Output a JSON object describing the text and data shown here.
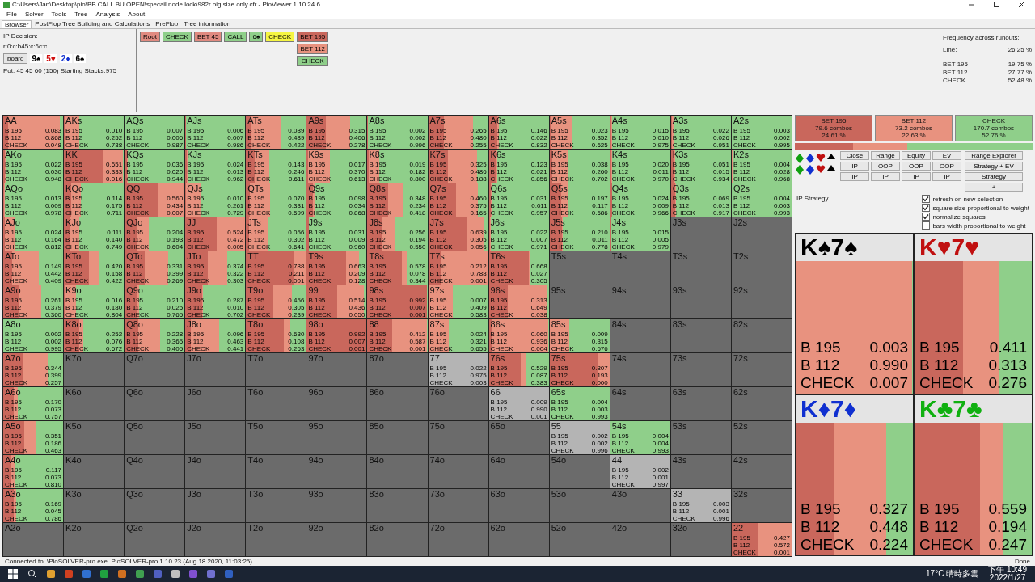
{
  "window": {
    "title": "C:\\Users\\Jan\\Desktop\\pio\\BB CALL BU OPEN\\specail node lock\\982r big size only.cfr - PioViewer 1.10.24.6"
  },
  "menu": [
    "File",
    "Solver",
    "Tools",
    "Tree",
    "Analysis",
    "About"
  ],
  "tabs": [
    {
      "label": "Browser",
      "selected": true
    },
    {
      "label": "PostFlop Tree Building and Calculations",
      "selected": false
    },
    {
      "label": "PreFlop",
      "selected": false
    },
    {
      "label": "Tree information",
      "selected": false
    }
  ],
  "decision": {
    "title": "IP Decision:",
    "line": "r:0:c:b45:c:6c:c",
    "board_button": "board",
    "cards": [
      {
        "label": "9♠",
        "color": "#000000"
      },
      {
        "label": "5♥",
        "color": "#d01010"
      },
      {
        "label": "2♦",
        "color": "#1030d0"
      },
      {
        "label": "6♠",
        "color": "#000000"
      }
    ],
    "pot": "Pot: 45 45 60 (150) Starting Stacks:975"
  },
  "path": [
    {
      "label": "Root",
      "color": "#e08a80"
    },
    {
      "label": "CHECK",
      "color": "#8fcf8a"
    },
    {
      "label": "BET 45",
      "color": "#e08a80"
    },
    {
      "label": "CALL",
      "color": "#8fcf8a"
    },
    {
      "label": "6♠",
      "color": "#8fcf8a"
    },
    {
      "label": "CHECK",
      "color": "#f5f542"
    }
  ],
  "next_actions": [
    {
      "label": "BET 195",
      "color": "#c9675c"
    },
    {
      "label": "BET 112",
      "color": "#e8927f"
    },
    {
      "label": "CHECK",
      "color": "#8fcf8a"
    }
  ],
  "runouts": {
    "title": "Frequency across runouts:",
    "line_label": "Line:",
    "line_value": "26.25 %",
    "rows": [
      [
        "BET 195",
        "19.75 %"
      ],
      [
        "BET 112",
        "27.77 %"
      ],
      [
        "CHECK",
        "52.48 %"
      ]
    ]
  },
  "strategy": {
    "actions": [
      {
        "name": "BET 195",
        "combos": "79.6 combos",
        "percent": "24.61 %",
        "color": "#c9675c"
      },
      {
        "name": "BET 112",
        "combos": "73.2 combos",
        "percent": "22.63 %",
        "color": "#e8927f"
      },
      {
        "name": "CHECK",
        "combos": "170.7 combos",
        "percent": "52.76 %",
        "color": "#8fcf8a"
      }
    ]
  },
  "buttons": [
    "Close",
    "Range",
    "Equity",
    "EV",
    "IP",
    "OOP",
    "OOP",
    "OOP",
    "IP",
    "IP",
    "IP",
    "IP"
  ],
  "side_buttons": [
    "Range Explorer",
    "Strategy + EV",
    "Strategy",
    "+"
  ],
  "strategy_label": "IP Strategy",
  "options": [
    {
      "label": "refresh on new selection",
      "checked": true
    },
    {
      "label": "square size proportional to weight",
      "checked": true
    },
    {
      "label": "normalize squares",
      "checked": true
    },
    {
      "label": "bars width proportional to weight",
      "checked": false
    }
  ],
  "grid": [
    [
      {
        "hand": "AA",
        "lines": [
          [
            "B 195",
            "0.083"
          ],
          [
            "B 112",
            "0.868"
          ],
          [
            "CHECK",
            "0.048"
          ]
        ]
      },
      {
        "hand": "AKs",
        "lines": [
          [
            "B 195",
            "0.010"
          ],
          [
            "B 112",
            "0.252"
          ],
          [
            "CHECK",
            "0.738"
          ]
        ]
      },
      {
        "hand": "AQs",
        "lines": [
          [
            "B 195",
            "0.007"
          ],
          [
            "B 112",
            "0.006"
          ],
          [
            "CHECK",
            "0.987"
          ]
        ]
      },
      {
        "hand": "AJs",
        "lines": [
          [
            "B 195",
            "0.006"
          ],
          [
            "B 112",
            "0.007"
          ],
          [
            "CHECK",
            "0.986"
          ]
        ]
      },
      {
        "hand": "ATs",
        "lines": [
          [
            "B 195",
            "0.089"
          ],
          [
            "B 112",
            "0.489"
          ],
          [
            "CHECK",
            "0.422"
          ]
        ]
      },
      {
        "hand": "A9s",
        "lines": [
          [
            "B 195",
            "0.315"
          ],
          [
            "B 112",
            "0.406"
          ],
          [
            "CHECK",
            "0.278"
          ]
        ]
      },
      {
        "hand": "A8s",
        "lines": [
          [
            "B 195",
            "0.002"
          ],
          [
            "B 112",
            "0.002"
          ],
          [
            "CHECK",
            "0.996"
          ]
        ]
      },
      {
        "hand": "A7s",
        "lines": [
          [
            "B 195",
            "0.265"
          ],
          [
            "B 112",
            "0.480"
          ],
          [
            "CHECK",
            "0.255"
          ]
        ]
      },
      {
        "hand": "A6s",
        "lines": [
          [
            "B 195",
            "0.146"
          ],
          [
            "B 112",
            "0.022"
          ],
          [
            "CHECK",
            "0.832"
          ]
        ]
      },
      {
        "hand": "A5s",
        "lines": [
          [
            "B 195",
            "0.023"
          ],
          [
            "B 112",
            "0.352"
          ],
          [
            "CHECK",
            "0.625"
          ]
        ]
      },
      {
        "hand": "A4s",
        "lines": [
          [
            "B 195",
            "0.015"
          ],
          [
            "B 112",
            "0.010"
          ],
          [
            "CHECK",
            "0.975"
          ]
        ]
      },
      {
        "hand": "A3s",
        "lines": [
          [
            "B 195",
            "0.022"
          ],
          [
            "B 112",
            "0.026"
          ],
          [
            "CHECK",
            "0.951"
          ]
        ]
      },
      {
        "hand": "A2s",
        "lines": [
          [
            "B 195",
            "0.003"
          ],
          [
            "B 112",
            "0.002"
          ],
          [
            "CHECK",
            "0.995"
          ]
        ]
      }
    ],
    [
      {
        "hand": "AKo",
        "lines": [
          [
            "B 195",
            "0.022"
          ],
          [
            "B 112",
            "0.030"
          ],
          [
            "CHECK",
            "0.948"
          ]
        ]
      },
      {
        "hand": "KK",
        "lines": [
          [
            "B 195",
            "0.651"
          ],
          [
            "B 112",
            "0.333"
          ],
          [
            "CHECK",
            "0.016"
          ]
        ]
      },
      {
        "hand": "KQs",
        "lines": [
          [
            "B 195",
            "0.036"
          ],
          [
            "B 112",
            "0.020"
          ],
          [
            "CHECK",
            "0.944"
          ]
        ]
      },
      {
        "hand": "KJs",
        "lines": [
          [
            "B 195",
            "0.024"
          ],
          [
            "B 112",
            "0.013"
          ],
          [
            "CHECK",
            "0.962"
          ]
        ]
      },
      {
        "hand": "KTs",
        "lines": [
          [
            "B 195",
            "0.143"
          ],
          [
            "B 112",
            "0.246"
          ],
          [
            "CHECK",
            "0.611"
          ]
        ]
      },
      {
        "hand": "K9s",
        "lines": [
          [
            "B 195",
            "0.017"
          ],
          [
            "B 112",
            "0.370"
          ],
          [
            "CHECK",
            "0.613"
          ]
        ]
      },
      {
        "hand": "K8s",
        "lines": [
          [
            "B 195",
            "0.019"
          ],
          [
            "B 112",
            "0.182"
          ],
          [
            "CHECK",
            "0.800"
          ]
        ]
      },
      {
        "hand": "K7s",
        "lines": [
          [
            "B 195",
            "0.325"
          ],
          [
            "B 112",
            "0.486"
          ],
          [
            "CHECK",
            "0.188"
          ]
        ]
      },
      {
        "hand": "K6s",
        "lines": [
          [
            "B 195",
            "0.123"
          ],
          [
            "B 112",
            "0.021"
          ],
          [
            "CHECK",
            "0.856"
          ]
        ]
      },
      {
        "hand": "K5s",
        "lines": [
          [
            "B 195",
            "0.038"
          ],
          [
            "B 112",
            "0.260"
          ],
          [
            "CHECK",
            "0.702"
          ]
        ]
      },
      {
        "hand": "K4s",
        "lines": [
          [
            "B 195",
            "0.020"
          ],
          [
            "B 112",
            "0.011"
          ],
          [
            "CHECK",
            "0.970"
          ]
        ]
      },
      {
        "hand": "K3s",
        "lines": [
          [
            "B 195",
            "0.051"
          ],
          [
            "B 112",
            "0.015"
          ],
          [
            "CHECK",
            "0.934"
          ]
        ]
      },
      {
        "hand": "K2s",
        "lines": [
          [
            "B 195",
            "0.004"
          ],
          [
            "B 112",
            "0.028"
          ],
          [
            "CHECK",
            "0.968"
          ]
        ]
      }
    ],
    [
      {
        "hand": "AQo",
        "lines": [
          [
            "B 195",
            "0.013"
          ],
          [
            "B 112",
            "0.009"
          ],
          [
            "CHECK",
            "0.978"
          ]
        ]
      },
      {
        "hand": "KQo",
        "lines": [
          [
            "B 195",
            "0.114"
          ],
          [
            "B 112",
            "0.175"
          ],
          [
            "CHECK",
            "0.711"
          ]
        ]
      },
      {
        "hand": "QQ",
        "lines": [
          [
            "B 195",
            "0.560"
          ],
          [
            "B 112",
            "0.434"
          ],
          [
            "CHECK",
            "0.007"
          ]
        ]
      },
      {
        "hand": "QJs",
        "lines": [
          [
            "B 195",
            "0.010"
          ],
          [
            "B 112",
            "0.261"
          ],
          [
            "CHECK",
            "0.729"
          ]
        ]
      },
      {
        "hand": "QTs",
        "lines": [
          [
            "B 195",
            "0.070"
          ],
          [
            "B 112",
            "0.331"
          ],
          [
            "CHECK",
            "0.599"
          ]
        ]
      },
      {
        "hand": "Q9s",
        "lines": [
          [
            "B 195",
            "0.098"
          ],
          [
            "B 112",
            "0.034"
          ],
          [
            "CHECK",
            "0.868"
          ]
        ]
      },
      {
        "hand": "Q8s",
        "lines": [
          [
            "B 195",
            "0.348"
          ],
          [
            "B 112",
            "0.234"
          ],
          [
            "CHECK",
            "0.418"
          ]
        ]
      },
      {
        "hand": "Q7s",
        "lines": [
          [
            "B 195",
            "0.460"
          ],
          [
            "B 112",
            "0.375"
          ],
          [
            "CHECK",
            "0.165"
          ]
        ]
      },
      {
        "hand": "Q6s",
        "lines": [
          [
            "B 195",
            "0.031"
          ],
          [
            "B 112",
            "0.011"
          ],
          [
            "CHECK",
            "0.957"
          ]
        ]
      },
      {
        "hand": "Q5s",
        "lines": [
          [
            "B 195",
            "0.197"
          ],
          [
            "B 112",
            "0.117"
          ],
          [
            "CHECK",
            "0.686"
          ]
        ]
      },
      {
        "hand": "Q4s",
        "lines": [
          [
            "B 195",
            "0.024"
          ],
          [
            "B 112",
            "0.009"
          ],
          [
            "CHECK",
            "0.966"
          ]
        ]
      },
      {
        "hand": "Q3s",
        "lines": [
          [
            "B 195",
            "0.069"
          ],
          [
            "B 112",
            "0.013"
          ],
          [
            "CHECK",
            "0.917"
          ]
        ]
      },
      {
        "hand": "Q2s",
        "lines": [
          [
            "B 195",
            "0.004"
          ],
          [
            "B 112",
            "0.003"
          ],
          [
            "CHECK",
            "0.993"
          ]
        ]
      }
    ],
    [
      {
        "hand": "AJo",
        "lines": [
          [
            "B 195",
            "0.024"
          ],
          [
            "B 112",
            "0.164"
          ],
          [
            "CHECK",
            "0.812"
          ]
        ]
      },
      {
        "hand": "KJo",
        "lines": [
          [
            "B 195",
            "0.111"
          ],
          [
            "B 112",
            "0.140"
          ],
          [
            "CHECK",
            "0.749"
          ]
        ]
      },
      {
        "hand": "QJo",
        "lines": [
          [
            "B 195",
            "0.204"
          ],
          [
            "B 112",
            "0.193"
          ],
          [
            "CHECK",
            "0.604"
          ]
        ]
      },
      {
        "hand": "JJ",
        "lines": [
          [
            "B 195",
            "0.524"
          ],
          [
            "B 112",
            "0.472"
          ],
          [
            "CHECK",
            "0.005"
          ]
        ]
      },
      {
        "hand": "JTs",
        "lines": [
          [
            "B 195",
            "0.056"
          ],
          [
            "B 112",
            "0.302"
          ],
          [
            "CHECK",
            "0.641"
          ]
        ]
      },
      {
        "hand": "J9s",
        "lines": [
          [
            "B 195",
            "0.031"
          ],
          [
            "B 112",
            "0.009"
          ],
          [
            "CHECK",
            "0.960"
          ]
        ]
      },
      {
        "hand": "J8s",
        "lines": [
          [
            "B 195",
            "0.256"
          ],
          [
            "B 112",
            "0.194"
          ],
          [
            "CHECK",
            "0.550"
          ]
        ]
      },
      {
        "hand": "J7s",
        "lines": [
          [
            "B 195",
            "0.639"
          ],
          [
            "B 112",
            "0.305"
          ],
          [
            "CHECK",
            "0.056"
          ]
        ]
      },
      {
        "hand": "J6s",
        "lines": [
          [
            "B 195",
            "0.022"
          ],
          [
            "B 112",
            "0.007"
          ],
          [
            "CHECK",
            "0.971"
          ]
        ]
      },
      {
        "hand": "J5s",
        "lines": [
          [
            "B 195",
            "0.210"
          ],
          [
            "B 112",
            "0.011"
          ],
          [
            "CHECK",
            "0.778"
          ]
        ]
      },
      {
        "hand": "J4s",
        "lines": [
          [
            "B 195",
            "0.015"
          ],
          [
            "B 112",
            "0.005"
          ],
          [
            "CHECK",
            "0.979"
          ]
        ]
      },
      {
        "hand": "J3s"
      },
      {
        "hand": "J2s"
      }
    ],
    [
      {
        "hand": "ATo",
        "lines": [
          [
            "B 195",
            "0.149"
          ],
          [
            "B 112",
            "0.442"
          ],
          [
            "CHECK",
            "0.409"
          ]
        ]
      },
      {
        "hand": "KTo",
        "lines": [
          [
            "B 195",
            "0.420"
          ],
          [
            "B 112",
            "0.158"
          ],
          [
            "CHECK",
            "0.422"
          ]
        ]
      },
      {
        "hand": "QTo",
        "lines": [
          [
            "B 195",
            "0.331"
          ],
          [
            "B 112",
            "0.399"
          ],
          [
            "CHECK",
            "0.269"
          ]
        ]
      },
      {
        "hand": "JTo",
        "lines": [
          [
            "B 195",
            "0.374"
          ],
          [
            "B 112",
            "0.322"
          ],
          [
            "CHECK",
            "0.303"
          ]
        ]
      },
      {
        "hand": "TT",
        "lines": [
          [
            "B 195",
            "0.788"
          ],
          [
            "B 112",
            "0.211"
          ],
          [
            "CHECK",
            "0.001"
          ]
        ]
      },
      {
        "hand": "T9s",
        "lines": [
          [
            "B 195",
            "0.663"
          ],
          [
            "B 112",
            "0.209"
          ],
          [
            "CHECK",
            "0.128"
          ]
        ]
      },
      {
        "hand": "T8s",
        "lines": [
          [
            "B 195",
            "0.578"
          ],
          [
            "B 112",
            "0.078"
          ],
          [
            "CHECK",
            "0.344"
          ]
        ]
      },
      {
        "hand": "T7s",
        "lines": [
          [
            "B 195",
            "0.212"
          ],
          [
            "B 112",
            "0.788"
          ],
          [
            "CHECK",
            "0.001"
          ]
        ]
      },
      {
        "hand": "T6s",
        "lines": [
          [
            "B 195",
            "0.668"
          ],
          [
            "B 112",
            "0.027"
          ],
          [
            "CHECK",
            "0.305"
          ]
        ]
      },
      {
        "hand": "T5s"
      },
      {
        "hand": "T4s"
      },
      {
        "hand": "T3s"
      },
      {
        "hand": "T2s"
      }
    ],
    [
      {
        "hand": "A9o",
        "lines": [
          [
            "B 195",
            "0.261"
          ],
          [
            "B 112",
            "0.379"
          ],
          [
            "CHECK",
            "0.360"
          ]
        ]
      },
      {
        "hand": "K9o",
        "lines": [
          [
            "B 195",
            "0.016"
          ],
          [
            "B 112",
            "0.180"
          ],
          [
            "CHECK",
            "0.804"
          ]
        ]
      },
      {
        "hand": "Q9o",
        "lines": [
          [
            "B 195",
            "0.210"
          ],
          [
            "B 112",
            "0.025"
          ],
          [
            "CHECK",
            "0.765"
          ]
        ]
      },
      {
        "hand": "J9o",
        "lines": [
          [
            "B 195",
            "0.287"
          ],
          [
            "B 112",
            "0.010"
          ],
          [
            "CHECK",
            "0.702"
          ]
        ]
      },
      {
        "hand": "T9o",
        "lines": [
          [
            "B 195",
            "0.456"
          ],
          [
            "B 112",
            "0.305"
          ],
          [
            "CHECK",
            "0.239"
          ]
        ]
      },
      {
        "hand": "99",
        "lines": [
          [
            "B 195",
            "0.514"
          ],
          [
            "B 112",
            "0.436"
          ],
          [
            "CHECK",
            "0.050"
          ]
        ]
      },
      {
        "hand": "98s",
        "lines": [
          [
            "B 195",
            "0.992"
          ],
          [
            "B 112",
            "0.007"
          ],
          [
            "CHECK",
            "0.001"
          ]
        ]
      },
      {
        "hand": "97s",
        "lines": [
          [
            "B 195",
            "0.007"
          ],
          [
            "B 112",
            "0.409"
          ],
          [
            "CHECK",
            "0.583"
          ]
        ]
      },
      {
        "hand": "96s",
        "lines": [
          [
            "B 195",
            "0.313"
          ],
          [
            "B 112",
            "0.649"
          ],
          [
            "CHECK",
            "0.038"
          ]
        ]
      },
      {
        "hand": "95s"
      },
      {
        "hand": "94s"
      },
      {
        "hand": "93s"
      },
      {
        "hand": "92s"
      }
    ],
    [
      {
        "hand": "A8o",
        "lines": [
          [
            "B 195",
            "0.002"
          ],
          [
            "B 112",
            "0.002"
          ],
          [
            "CHECK",
            "0.995"
          ]
        ]
      },
      {
        "hand": "K8o",
        "lines": [
          [
            "B 195",
            "0.252"
          ],
          [
            "B 112",
            "0.076"
          ],
          [
            "CHECK",
            "0.672"
          ]
        ]
      },
      {
        "hand": "Q8o",
        "lines": [
          [
            "B 195",
            "0.228"
          ],
          [
            "B 112",
            "0.365"
          ],
          [
            "CHECK",
            "0.405"
          ]
        ]
      },
      {
        "hand": "J8o",
        "lines": [
          [
            "B 195",
            "0.096"
          ],
          [
            "B 112",
            "0.463"
          ],
          [
            "CHECK",
            "0.441"
          ]
        ]
      },
      {
        "hand": "T8o",
        "lines": [
          [
            "B 195",
            "0.630"
          ],
          [
            "B 112",
            "0.108"
          ],
          [
            "CHECK",
            "0.263"
          ]
        ]
      },
      {
        "hand": "98o",
        "lines": [
          [
            "B 195",
            "0.992"
          ],
          [
            "B 112",
            "0.007"
          ],
          [
            "CHECK",
            "0.001"
          ]
        ]
      },
      {
        "hand": "88",
        "lines": [
          [
            "B 195",
            "0.412"
          ],
          [
            "B 112",
            "0.587"
          ],
          [
            "CHECK",
            "0.001"
          ]
        ]
      },
      {
        "hand": "87s",
        "lines": [
          [
            "B 195",
            "0.024"
          ],
          [
            "B 112",
            "0.321"
          ],
          [
            "CHECK",
            "0.655"
          ]
        ]
      },
      {
        "hand": "86s",
        "lines": [
          [
            "B 195",
            "0.060"
          ],
          [
            "B 112",
            "0.936"
          ],
          [
            "CHECK",
            "0.004"
          ]
        ]
      },
      {
        "hand": "85s",
        "lines": [
          [
            "B 195",
            "0.009"
          ],
          [
            "B 112",
            "0.315"
          ],
          [
            "CHECK",
            "0.676"
          ]
        ]
      },
      {
        "hand": "84s"
      },
      {
        "hand": "83s"
      },
      {
        "hand": "82s"
      }
    ],
    [
      {
        "hand": "A7o",
        "lines": [
          [
            "B 195",
            "0.344"
          ],
          [
            "B 112",
            "0.399"
          ],
          [
            "CHECK",
            "0.257"
          ]
        ]
      },
      {
        "hand": "K7o"
      },
      {
        "hand": "Q7o"
      },
      {
        "hand": "J7o"
      },
      {
        "hand": "T7o"
      },
      {
        "hand": "97o"
      },
      {
        "hand": "87o"
      },
      {
        "hand": "77",
        "shaded": true,
        "lines": [
          [
            "B 195",
            "0.022"
          ],
          [
            "B 112",
            "0.975"
          ],
          [
            "CHECK",
            "0.003"
          ]
        ]
      },
      {
        "hand": "76s",
        "lines": [
          [
            "B 195",
            "0.529"
          ],
          [
            "B 112",
            "0.087"
          ],
          [
            "CHECK",
            "0.383"
          ]
        ]
      },
      {
        "hand": "75s",
        "lines": [
          [
            "B 195",
            "0.807"
          ],
          [
            "B 112",
            "0.193"
          ],
          [
            "CHECK",
            "0.000"
          ]
        ]
      },
      {
        "hand": "74s"
      },
      {
        "hand": "73s"
      },
      {
        "hand": "72s"
      }
    ],
    [
      {
        "hand": "A6o",
        "lines": [
          [
            "B 195",
            "0.170"
          ],
          [
            "B 112",
            "0.073"
          ],
          [
            "CHECK",
            "0.757"
          ]
        ]
      },
      {
        "hand": "K6o"
      },
      {
        "hand": "Q6o"
      },
      {
        "hand": "J6o"
      },
      {
        "hand": "T6o"
      },
      {
        "hand": "96o"
      },
      {
        "hand": "86o"
      },
      {
        "hand": "76o"
      },
      {
        "hand": "66",
        "shaded": true,
        "lines": [
          [
            "B 195",
            "0.009"
          ],
          [
            "B 112",
            "0.990"
          ],
          [
            "CHECK",
            "0.001"
          ]
        ]
      },
      {
        "hand": "65s",
        "lines": [
          [
            "B 195",
            "0.004"
          ],
          [
            "B 112",
            "0.003"
          ],
          [
            "CHECK",
            "0.993"
          ]
        ]
      },
      {
        "hand": "64s"
      },
      {
        "hand": "63s"
      },
      {
        "hand": "62s"
      }
    ],
    [
      {
        "hand": "A5o",
        "lines": [
          [
            "B 195",
            "0.351"
          ],
          [
            "B 112",
            "0.186"
          ],
          [
            "CHECK",
            "0.463"
          ]
        ]
      },
      {
        "hand": "K5o"
      },
      {
        "hand": "Q5o"
      },
      {
        "hand": "J5o"
      },
      {
        "hand": "T5o"
      },
      {
        "hand": "95o"
      },
      {
        "hand": "85o"
      },
      {
        "hand": "75o"
      },
      {
        "hand": "65o"
      },
      {
        "hand": "55",
        "shaded": true,
        "lines": [
          [
            "B 195",
            "0.002"
          ],
          [
            "B 112",
            "0.002"
          ],
          [
            "CHECK",
            "0.996"
          ]
        ]
      },
      {
        "hand": "54s",
        "lines": [
          [
            "B 195",
            "0.004"
          ],
          [
            "B 112",
            "0.004"
          ],
          [
            "CHECK",
            "0.993"
          ]
        ]
      },
      {
        "hand": "53s"
      },
      {
        "hand": "52s"
      }
    ],
    [
      {
        "hand": "A4o",
        "lines": [
          [
            "B 195",
            "0.117"
          ],
          [
            "B 112",
            "0.073"
          ],
          [
            "CHECK",
            "0.810"
          ]
        ]
      },
      {
        "hand": "K4o"
      },
      {
        "hand": "Q4o"
      },
      {
        "hand": "J4o"
      },
      {
        "hand": "T4o"
      },
      {
        "hand": "94o"
      },
      {
        "hand": "84o"
      },
      {
        "hand": "74o"
      },
      {
        "hand": "64o"
      },
      {
        "hand": "54o"
      },
      {
        "hand": "44",
        "shaded": true,
        "lines": [
          [
            "B 195",
            "0.002"
          ],
          [
            "B 112",
            "0.001"
          ],
          [
            "CHECK",
            "0.997"
          ]
        ]
      },
      {
        "hand": "43s"
      },
      {
        "hand": "42s"
      }
    ],
    [
      {
        "hand": "A3o",
        "shaded": false,
        "lines": [
          [
            "B 195",
            "0.169"
          ],
          [
            "B 112",
            "0.045"
          ],
          [
            "CHECK",
            "0.786"
          ]
        ]
      },
      {
        "hand": "K3o"
      },
      {
        "hand": "Q3o"
      },
      {
        "hand": "J3o"
      },
      {
        "hand": "T3o"
      },
      {
        "hand": "93o"
      },
      {
        "hand": "83o"
      },
      {
        "hand": "73o"
      },
      {
        "hand": "63o"
      },
      {
        "hand": "53o"
      },
      {
        "hand": "43o"
      },
      {
        "hand": "33",
        "shaded": true,
        "lines": [
          [
            "B 195",
            "0.003"
          ],
          [
            "B 112",
            "0.001"
          ],
          [
            "CHECK",
            "0.996"
          ]
        ]
      },
      {
        "hand": "32s"
      }
    ],
    [
      {
        "hand": "A2o"
      },
      {
        "hand": "K2o"
      },
      {
        "hand": "Q2o"
      },
      {
        "hand": "J2o"
      },
      {
        "hand": "T2o"
      },
      {
        "hand": "92o"
      },
      {
        "hand": "82o"
      },
      {
        "hand": "72o"
      },
      {
        "hand": "62o"
      },
      {
        "hand": "52o"
      },
      {
        "hand": "42o"
      },
      {
        "hand": "32o"
      },
      {
        "hand": "22",
        "lines": [
          [
            "B 195",
            "0.427"
          ],
          [
            "B 112",
            "0.572"
          ],
          [
            "CHECK",
            "0.001"
          ]
        ]
      }
    ]
  ],
  "combos": [
    {
      "hand": "K♠7♠",
      "color": "#000000",
      "lines": [
        [
          "B 195",
          "0.003"
        ],
        [
          "B 112",
          "0.990"
        ],
        [
          "CHECK",
          "0.007"
        ]
      ]
    },
    {
      "hand": "K♥7♥",
      "color": "#c01010",
      "lines": [
        [
          "B 195",
          "0.411"
        ],
        [
          "B 112",
          "0.313"
        ],
        [
          "CHECK",
          "0.276"
        ]
      ]
    },
    {
      "hand": "K♦7♦",
      "color": "#1030d0",
      "lines": [
        [
          "B 195",
          "0.327"
        ],
        [
          "B 112",
          "0.448"
        ],
        [
          "CHECK",
          "0.224"
        ]
      ]
    },
    {
      "hand": "K♣7♣",
      "color": "#10b010",
      "lines": [
        [
          "B 195",
          "0.559"
        ],
        [
          "B 112",
          "0.194"
        ],
        [
          "CHECK",
          "0.247"
        ]
      ]
    }
  ],
  "status_bar": {
    "message": "Connected to .\\PioSOLVER-pro.exe. PioSOLVER-pro 1.10.23 (Aug 18 2020, 11:03:25)",
    "state": "Done"
  },
  "taskbar": {
    "weather": "17°C 晴時多雲",
    "time": "下午 10:49",
    "date": "2022/1/27"
  }
}
